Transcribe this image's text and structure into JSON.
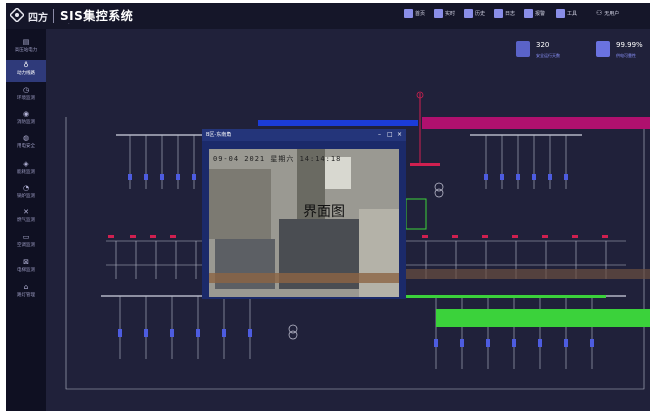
{
  "header": {
    "brand": "四方",
    "title": "SIS集控系统",
    "subtitle": "-",
    "nav": [
      {
        "label": "首页",
        "icon": "home-icon"
      },
      {
        "label": "实时",
        "icon": "realtime-icon"
      },
      {
        "label": "历史",
        "icon": "history-icon"
      },
      {
        "label": "日志",
        "icon": "log-icon"
      },
      {
        "label": "报警",
        "icon": "alarm-icon"
      },
      {
        "label": "工具",
        "icon": "tools-icon"
      }
    ],
    "user": "无用户"
  },
  "sidebar": {
    "items": [
      {
        "label": "高压站电力",
        "icon": "building-icon"
      },
      {
        "label": "动力线路",
        "icon": "lightbulb-icon",
        "active": true
      },
      {
        "label": "环境监测",
        "icon": "clock-icon"
      },
      {
        "label": "消防监测",
        "icon": "fire-icon"
      },
      {
        "label": "用电安全",
        "icon": "shield-icon"
      },
      {
        "label": "能耗监测",
        "icon": "energy-icon"
      },
      {
        "label": "锅炉监测",
        "icon": "boiler-icon"
      },
      {
        "label": "燃气监测",
        "icon": "gas-icon"
      },
      {
        "label": "空调监测",
        "icon": "aircon-icon"
      },
      {
        "label": "电梯监测",
        "icon": "elevator-icon"
      },
      {
        "label": "路灯管理",
        "icon": "streetlight-icon"
      }
    ]
  },
  "stats": [
    {
      "value": "320",
      "label": "安全运行天数",
      "icon": "calendar-icon"
    },
    {
      "value": "99.99%",
      "label": "供电可靠性",
      "icon": "diamond-icon"
    }
  ],
  "popup": {
    "title": "B区-东南角",
    "timestamp": "09-04 2021 星期六 14:14:18",
    "overlay_label": "界面图"
  },
  "colors": {
    "background": "#20213a",
    "topbar": "#151629",
    "sidebar": "#0f1022",
    "sidebar_active": "#2f3a7a",
    "accent": "#5a63c8",
    "line": "#b8bccc",
    "alarm": "#d02050",
    "ok": "#3bd23b",
    "breaker": "#4d5ce0"
  }
}
